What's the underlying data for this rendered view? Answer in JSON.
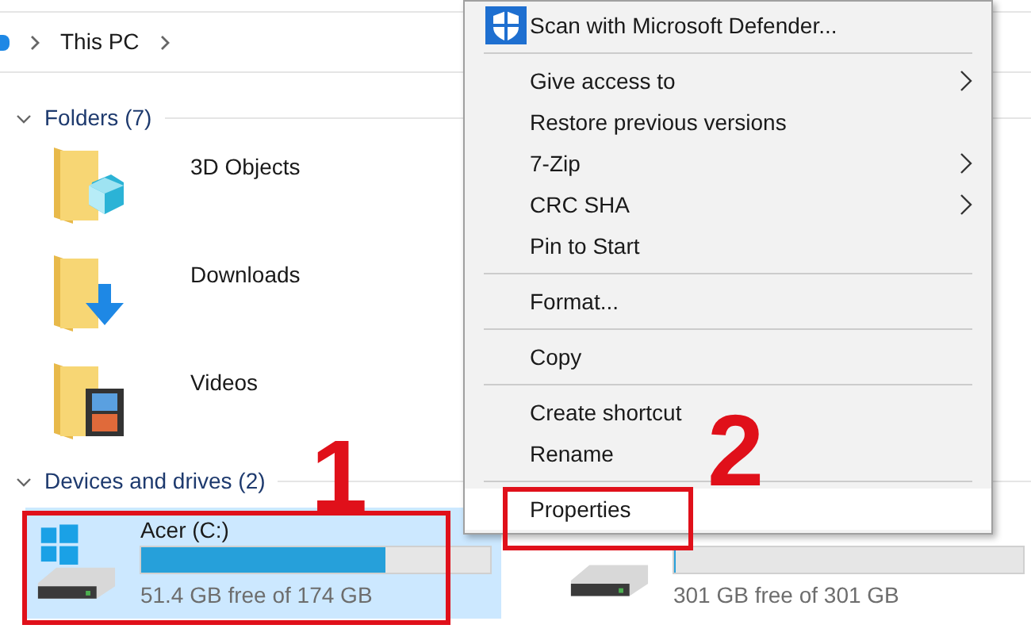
{
  "breadcrumb": {
    "items": [
      "This PC"
    ]
  },
  "groups": [
    {
      "title": "Folders (7)",
      "expanded": true,
      "items": [
        {
          "name": "3D Objects"
        },
        {
          "name": "Downloads"
        },
        {
          "name": "Videos"
        }
      ]
    },
    {
      "title": "Devices and drives (2)",
      "expanded": true
    }
  ],
  "drives": [
    {
      "name": "Acer (C:)",
      "level": 0.7,
      "free": "51.4 GB free of 174 GB",
      "selected": true,
      "windows": true
    },
    {
      "level": 0.0,
      "free": "301 GB free of 301 GB",
      "selected": false,
      "windows": false
    }
  ],
  "context_menu": [
    {
      "kind": "icon_item",
      "label": "Scan with Microsoft Defender...",
      "submenu": false,
      "selected": false
    },
    {
      "kind": "separator"
    },
    {
      "kind": "item",
      "label": "Give access to",
      "submenu": true,
      "selected": false
    },
    {
      "kind": "item",
      "label": "Restore previous versions",
      "submenu": false,
      "selected": false
    },
    {
      "kind": "item",
      "label": "7-Zip",
      "submenu": true,
      "selected": false
    },
    {
      "kind": "item",
      "label": "CRC SHA",
      "submenu": true,
      "selected": false
    },
    {
      "kind": "item",
      "label": "Pin to Start",
      "submenu": false,
      "selected": false
    },
    {
      "kind": "separator"
    },
    {
      "kind": "item",
      "label": "Format...",
      "submenu": false,
      "selected": false
    },
    {
      "kind": "separator"
    },
    {
      "kind": "item",
      "label": "Copy",
      "submenu": false,
      "selected": false
    },
    {
      "kind": "separator"
    },
    {
      "kind": "item",
      "label": "Create shortcut",
      "submenu": false,
      "selected": false
    },
    {
      "kind": "item",
      "label": "Rename",
      "submenu": false,
      "selected": false
    },
    {
      "kind": "separator"
    },
    {
      "kind": "item",
      "label": "Properties",
      "submenu": false,
      "selected": true
    }
  ],
  "annotations": [
    "1",
    "2"
  ]
}
